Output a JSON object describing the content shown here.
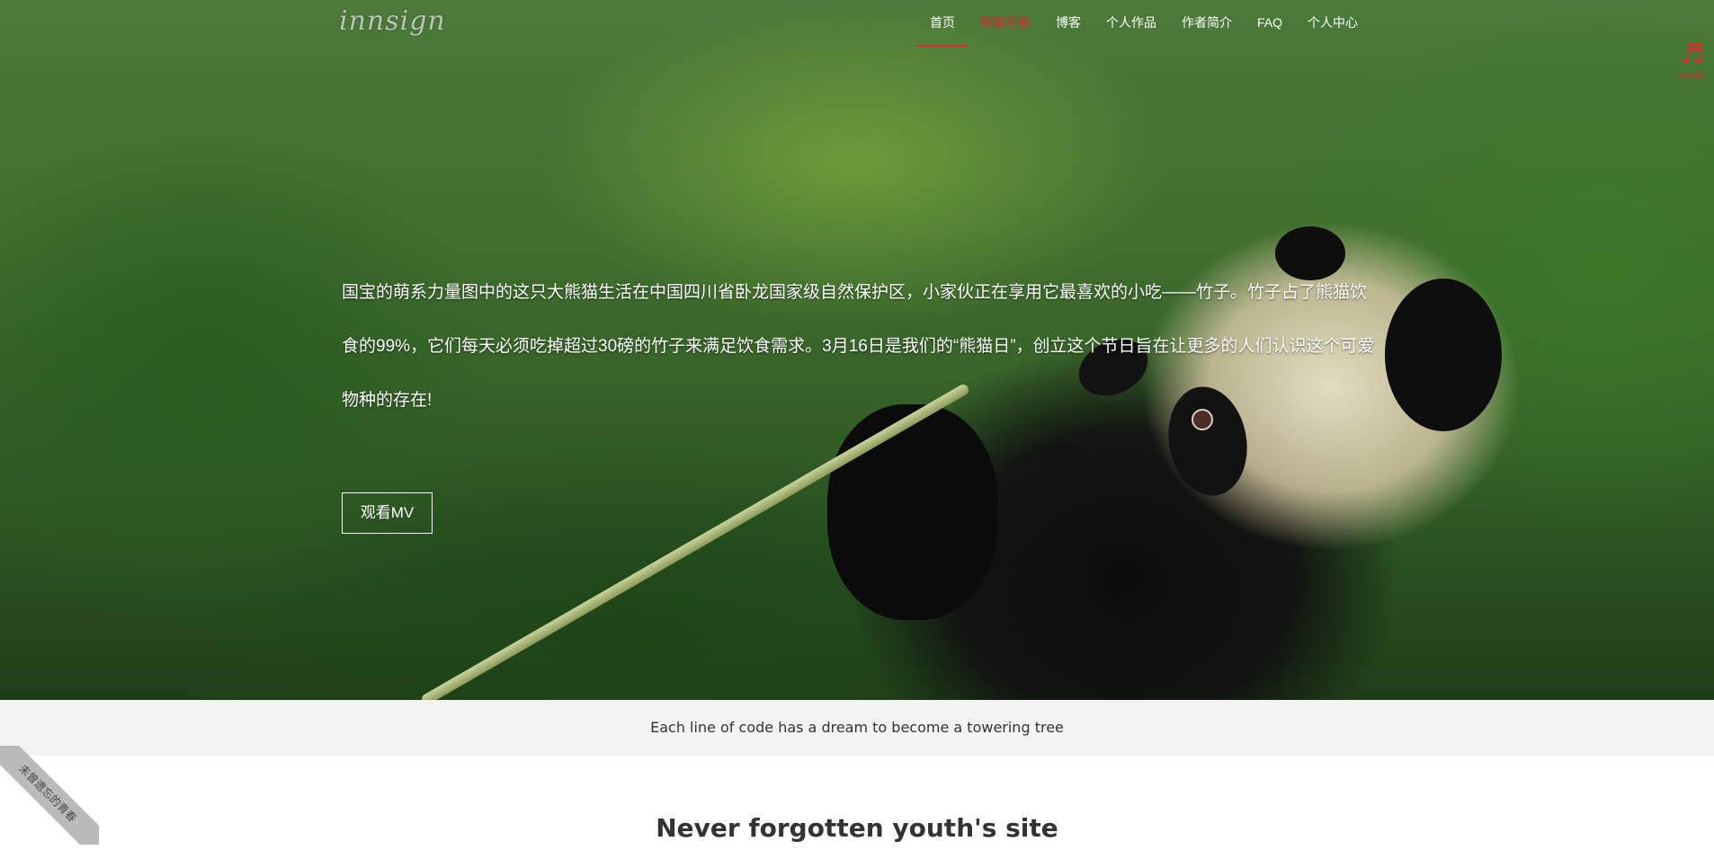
{
  "brand": {
    "logo_text": "innsign"
  },
  "nav": {
    "items": [
      {
        "label": "首页"
      },
      {
        "label": "熊猫手册"
      },
      {
        "label": "博客"
      },
      {
        "label": "个人作品"
      },
      {
        "label": "作者简介"
      },
      {
        "label": "FAQ"
      },
      {
        "label": "个人中心"
      }
    ]
  },
  "music": {
    "label": "music",
    "icon": "music-note-icon"
  },
  "hero": {
    "intro_text": "国宝的萌系力量图中的这只大熊猫生活在中国四川省卧龙国家级自然保护区，小家伙正在享用它最喜欢的小吃——竹子。竹子占了熊猫饮食的99%，它们每天必须吃掉超过30磅的竹子来满足饮食需求。3月16日是我们的“熊猫日”，创立这个节日旨在让更多的人们认识这个可爱物种的存在!",
    "button_label": "观看MV"
  },
  "motto": {
    "text": "Each line of code has a dream to become a towering tree"
  },
  "section": {
    "title": "Never forgotten youth's site"
  },
  "ribbon": {
    "text": "未曾遗忘的青春"
  },
  "colors": {
    "accent": "#e0262a",
    "motto_bg": "#f3f3f3",
    "text_dark": "#333333"
  }
}
